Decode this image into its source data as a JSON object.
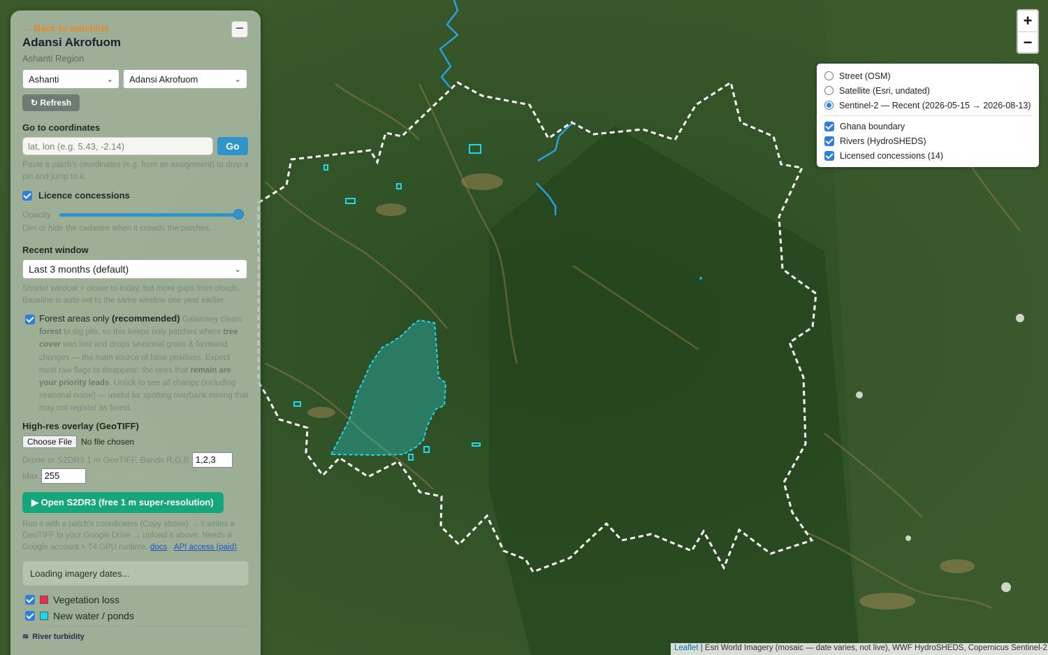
{
  "panel": {
    "back_label": "Back to watchlist",
    "site_title": "Adansi Akrofuom",
    "site_subtitle": "Ashanti Region",
    "region_select": "Ashanti",
    "district_select": "Adansi Akrofuom",
    "refresh_label": "Refresh",
    "coords_label": "Go to coordinates",
    "coords_placeholder": "lat, lon  (e.g. 5.43, -2.14)",
    "go_label": "Go",
    "coords_hint": "Paste a patch's coordinates (e.g. from an assignment) to drop a pin and jump to it.",
    "concessions_label": "Licence concessions",
    "concessions_checked": true,
    "opacity_label": "Opacity",
    "opacity_value": 1.0,
    "opacity_hint": "Dim or hide the cadastre when it crowds the patches.",
    "recent_window_label": "Recent window",
    "recent_window_value": "Last 3 months (default)",
    "recent_window_hint": "Shorter window = closer to today, but more gaps from clouds. Baseline is auto-set to the same window one year earlier.",
    "forest_only": {
      "checked": true,
      "lead": "Forest areas only ",
      "lead_bold": "(recommended)",
      "t1": " Galamsey clears ",
      "b1": "forest",
      "t2": " to dig pits, so this keeps only patches where ",
      "b2": "tree cover",
      "t3": " was lost and drops seasonal grass & farmland changes — the main source of false positives. Expect most raw flags to disappear; the ones that ",
      "b3": "remain are your priority leads",
      "t4": ". Untick to see ",
      "i1": "all",
      "t5": " change (including seasonal noise) — useful for spotting riverbank mining that may not register as forest."
    },
    "highres_label": "High-res overlay (GeoTIFF)",
    "choose_file_label": "Choose File",
    "no_file_label": "No file chosen",
    "bands_text": "Drone or S2DR3 1 m GeoTIFF. Bands R,G,B",
    "bands_value": "1,2,3",
    "max_label": "Max",
    "max_value": "255",
    "max_hint": "(S2DR3 ≈ 3000)",
    "s2dr3_button": "Open S2DR3 (free 1 m super-resolution)",
    "s2dr3_hint": "Run it with a patch's coordinates (Copy above) → it writes a GeoTIFF to your Google Drive → upload it above. Needs a Google account + T4 GPU runtime.",
    "docs_link": "docs",
    "api_link": "API access (paid)",
    "loading_text": "Loading imagery dates...",
    "layers": [
      {
        "label": "Vegetation loss",
        "checked": true,
        "color": "#ee2b4f"
      },
      {
        "label": "New water / ponds",
        "checked": true,
        "color": "#19d6ea"
      }
    ],
    "turbidity_label": "River turbidity"
  },
  "map": {
    "zoom_in": "+",
    "zoom_out": "−",
    "base_layers": [
      {
        "label": "Street (OSM)",
        "selected": false
      },
      {
        "label": "Satellite (Esri, undated)",
        "selected": false
      },
      {
        "label": "Sentinel-2 — Recent (2026-05-15 → 2026-08-13)",
        "selected": true
      }
    ],
    "overlays": [
      {
        "label": "Ghana boundary",
        "checked": true
      },
      {
        "label": "Rivers (HydroSHEDS)",
        "checked": true
      },
      {
        "label": "Licensed concessions (14)",
        "checked": true
      }
    ],
    "attribution_leaflet": "Leaflet",
    "attribution_rest": " | Esri World Imagery (mosaic — date varies, not live), WWF HydroSHEDS, Copernicus Sentinel-2",
    "colors": {
      "boundary": "#ffffff",
      "concession": "#22d8e8",
      "river": "#2aa0e0",
      "forest": "#2f4a26"
    }
  }
}
